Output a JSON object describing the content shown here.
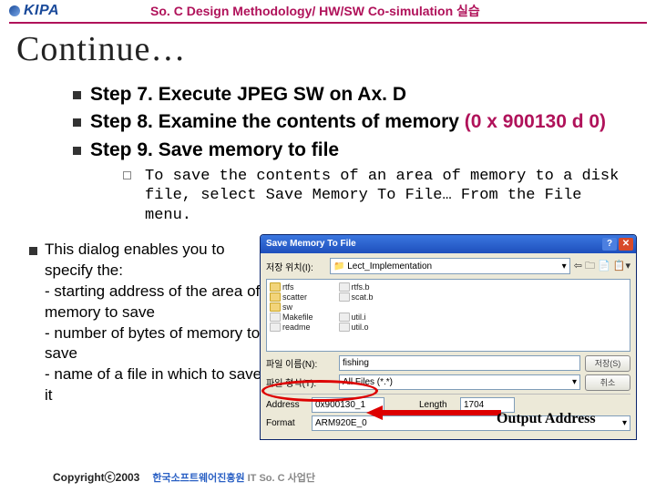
{
  "header": {
    "logo_text": "KIPA",
    "title": "So. C Design Methodology/ HW/SW Co-simulation 실습"
  },
  "slide": {
    "title": "Continue…"
  },
  "bullets": [
    "Step 7. Execute JPEG SW on Ax. D",
    "Step 8. Examine the contents of memory",
    "Step 9. Save memory to file"
  ],
  "mem_addr": "(0 x 900130 d 0)",
  "sub_hint": "To save the contents of an area of memory to a disk file, select Save Memory To File… From the File menu.",
  "left_text": "This dialog enables you to specify the:\n- starting address of the area of memory to save\n- number of bytes of memory to save\n- name of a file in which to save it",
  "dialog": {
    "title": "Save Memory To File",
    "nav_label": "저장 위치(I):",
    "nav_value": "📁 Lect_Implementation",
    "nav_hint": "⇦ 🗀 📄 📋▾",
    "files_col1": [
      "rtfs",
      "scatter",
      "sw",
      "Makefile",
      "readme"
    ],
    "files_col2": [
      "rtfs.b",
      "scat.b",
      "",
      "util.i",
      "util.o"
    ],
    "fname_label": "파일 이름(N):",
    "fname_value": "fishing",
    "ftype_label": "파일 형식(T):",
    "ftype_value": "All Files (*.*)",
    "address_label": "Address",
    "address_value": "0x900130_1",
    "length_label": "Length",
    "length_value": "1704",
    "format_label": "Format",
    "format_value": "ARM920E_0",
    "btn_save": "저장(S)",
    "btn_cancel": "취소"
  },
  "output_label": "Output Address",
  "footer": {
    "copy": "Copyrightⓒ2003",
    "brand1": "한국소프트웨어진흥원",
    "brand2": "IT So. C 사업단"
  }
}
